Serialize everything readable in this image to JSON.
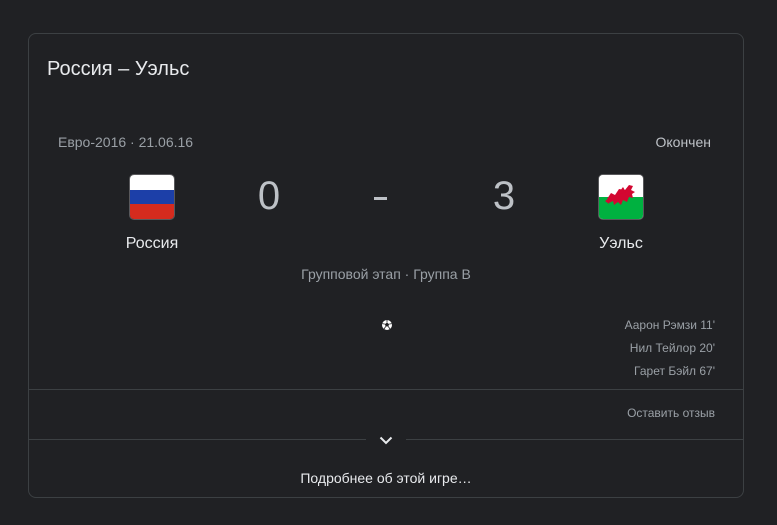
{
  "match": {
    "title": "Россия – Уэльс",
    "competition_date": "Евро-2016 · 21.06.16",
    "status": "Окончен",
    "stage": "Групповой этап · Группа B"
  },
  "home": {
    "name": "Россия",
    "score": "0",
    "flag_colors": [
      "#ffffff",
      "#1c3fa8",
      "#d52b1e"
    ]
  },
  "away": {
    "name": "Уэльс",
    "score": "3",
    "flag_colors": [
      "#ffffff",
      "#00b140",
      "#d30731"
    ]
  },
  "score_separator_icon": "dash-icon",
  "goal_icon": "soccer-ball-icon",
  "scorers": [
    "Аарон Рэмзи 11'",
    "Нил Тейлор 20'",
    "Гарет Бэйл 67'"
  ],
  "footer": {
    "feedback_label": "Оставить отзыв",
    "expand_icon": "chevron-down-icon",
    "more_label": "Подробнее об этой игре…"
  }
}
